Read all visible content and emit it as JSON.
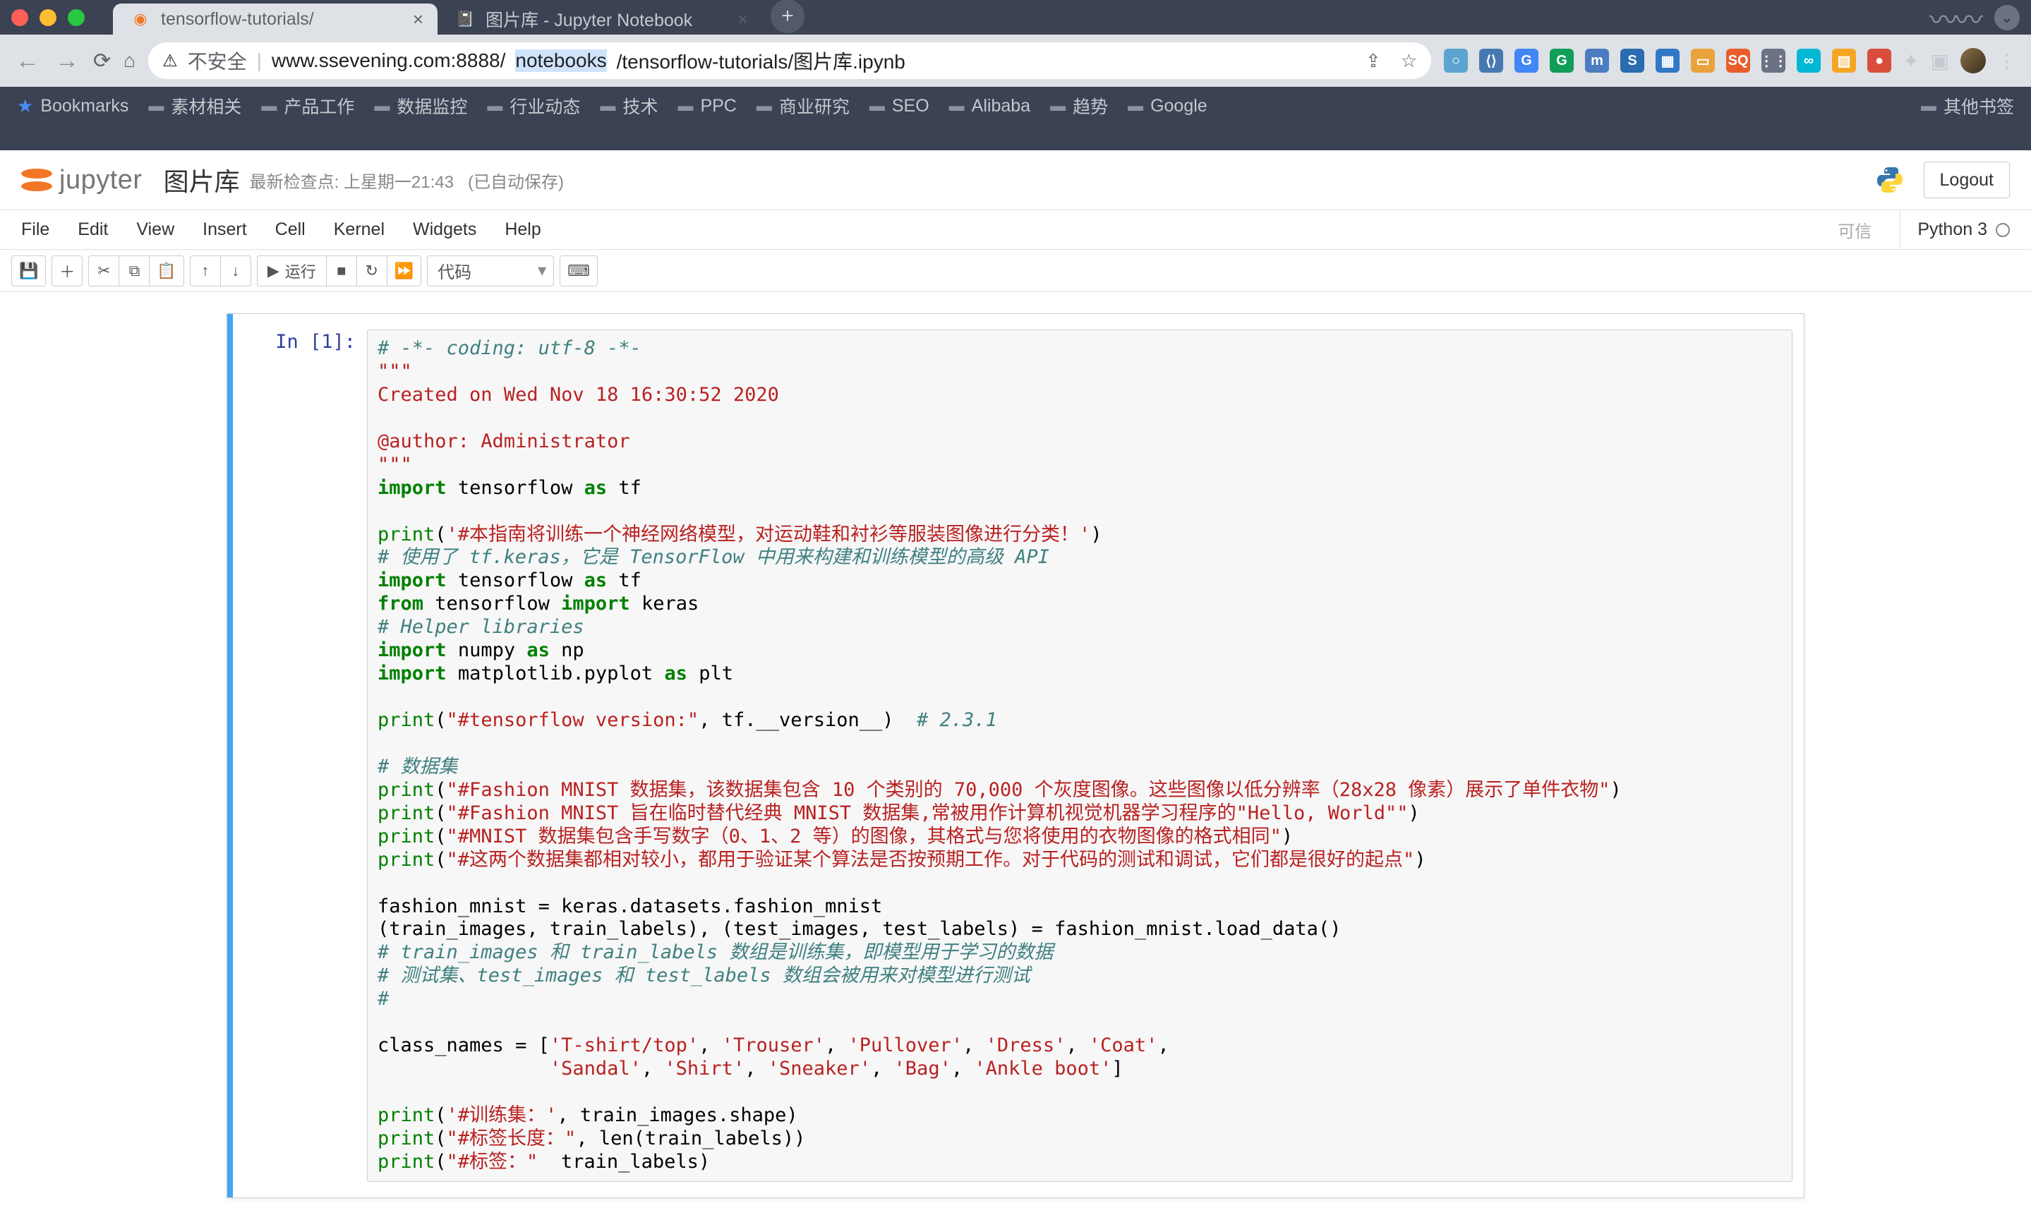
{
  "browser": {
    "tabs": [
      {
        "title": "tensorflow-tutorials/",
        "active": true
      },
      {
        "title": "图片库 - Jupyter Notebook",
        "active": false
      }
    ],
    "insecure_label": "不安全",
    "url_host": "www.ssevening.com:8888/",
    "url_selected": "notebooks",
    "url_rest": "/tensorflow-tutorials/图片库.ipynb",
    "bookmarks": [
      "Bookmarks",
      "素材相关",
      "产品工作",
      "数据监控",
      "行业动态",
      "技术",
      "PPC",
      "商业研究",
      "SEO",
      "Alibaba",
      "趋势",
      "Google"
    ],
    "bookmarks_right": "其他书签"
  },
  "jupyter": {
    "logo_text": "jupyter",
    "notebook_title": "图片库",
    "checkpoint": "最新检查点: 上星期一21:43",
    "autosaved": "(已自动保存)",
    "logout": "Logout",
    "menus": [
      "File",
      "Edit",
      "View",
      "Insert",
      "Cell",
      "Kernel",
      "Widgets",
      "Help"
    ],
    "trusted": "可信",
    "kernel_name": "Python 3",
    "run_label": "运行",
    "celltype": "代码",
    "prompt": "In [1]:"
  },
  "code": {
    "l01": "# -*- coding: utf-8 -*-",
    "l02": "\"\"\"",
    "l03": "Created on Wed Nov 18 16:30:52 2020",
    "l04": "",
    "l05": "@author: Administrator",
    "l06": "\"\"\"",
    "l07_kw1": "import",
    "l07_mod": "tensorflow",
    "l07_kw2": "as",
    "l07_al": "tf",
    "l08": "",
    "l09_fn": "print",
    "l09_str": "'#本指南将训练一个神经网络模型，对运动鞋和衬衫等服装图像进行分类！'",
    "l10": "# 使用了 tf.keras，它是 TensorFlow 中用来构建和训练模型的高级 API",
    "l11_kw1": "import",
    "l11_mod": "tensorflow",
    "l11_kw2": "as",
    "l11_al": "tf",
    "l12_kw1": "from",
    "l12_mod": "tensorflow",
    "l12_kw2": "import",
    "l12_nm": "keras",
    "l13": "# Helper libraries",
    "l14_kw1": "import",
    "l14_mod": "numpy",
    "l14_kw2": "as",
    "l14_al": "np",
    "l15_kw1": "import",
    "l15_mod": "matplotlib.pyplot",
    "l15_kw2": "as",
    "l15_al": "plt",
    "l16": "",
    "l17_fn": "print",
    "l17_str": "\"#tensorflow version:\"",
    "l17_rest": ", tf.__version__)  ",
    "l17_cm": "# 2.3.1",
    "l18": "",
    "l19": "# 数据集",
    "l20_fn": "print",
    "l20_str": "\"#Fashion MNIST 数据集，该数据集包含 10 个类别的 70,000 个灰度图像。这些图像以低分辨率（28x28 像素）展示了单件衣物\"",
    "l21_fn": "print",
    "l21_str": "\"#Fashion MNIST 旨在临时替代经典 MNIST 数据集,常被用作计算机视觉机器学习程序的\"Hello, World\"\"",
    "l22_fn": "print",
    "l22_str": "\"#MNIST 数据集包含手写数字（0、1、2 等）的图像，其格式与您将使用的衣物图像的格式相同\"",
    "l23_fn": "print",
    "l23_str": "\"#这两个数据集都相对较小，都用于验证某个算法是否按预期工作。对于代码的测试和调试，它们都是很好的起点\"",
    "l24": "",
    "l25": "fashion_mnist = keras.datasets.fashion_mnist",
    "l26": "(train_images, train_labels), (test_images, test_labels) = fashion_mnist.load_data()",
    "l27": "# train_images 和 train_labels 数组是训练集，即模型用于学习的数据",
    "l28": "# 测试集、test_images 和 test_labels 数组会被用来对模型进行测试",
    "l29": "#",
    "l30": "",
    "l31a": "class_names = [",
    "l31s1": "'T-shirt/top'",
    "l31s2": "'Trouser'",
    "l31s3": "'Pullover'",
    "l31s4": "'Dress'",
    "l31s5": "'Coat'",
    "l32_pad": "               ",
    "l32s1": "'Sandal'",
    "l32s2": "'Shirt'",
    "l32s3": "'Sneaker'",
    "l32s4": "'Bag'",
    "l32s5": "'Ankle boot'",
    "l33": "",
    "l34_fn": "print",
    "l34_str": "'#训练集：'",
    "l34_rest": ", train_images.shape)",
    "l35_fn": "print",
    "l35_str": "\"#标签长度：\"",
    "l35_rest": ", len(train_labels))",
    "l36_fn": "print",
    "l36_str": "\"#标签：\"",
    "l36_rest": "  train_labels)"
  }
}
